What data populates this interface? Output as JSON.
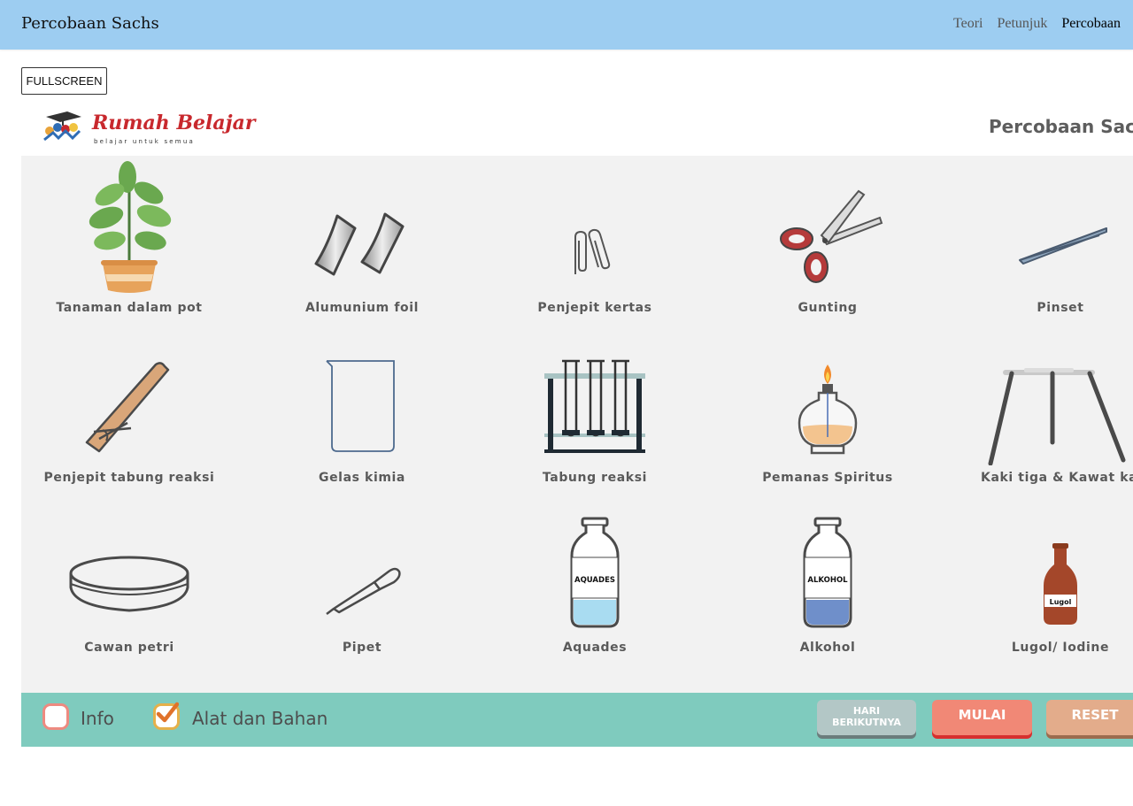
{
  "navbar": {
    "brand": "Percobaan Sachs",
    "links": [
      "Teori",
      "Petunjuk",
      "Percobaan"
    ]
  },
  "fullscreen_label": "FULLSCREEN",
  "simulation": {
    "logo_title": "Rumah Belajar",
    "logo_subtitle": "belajar untuk semua",
    "title": "Percobaan Sachs",
    "items": [
      "Tanaman dalam pot",
      "Alumunium foil",
      "Penjepit kertas",
      "Gunting",
      "Pinset",
      "Penjepit tabung reaksi",
      "Gelas kimia",
      "Tabung reaksi",
      "Pemanas Spiritus",
      "Kaki tiga & Kawat kasa",
      "Cawan petri",
      "Pipet",
      "Aquades",
      "Alkohol",
      "Lugol/ Iodine"
    ],
    "bottle_labels": {
      "aquades": "AQUADES",
      "alkohol": "ALKOHOL",
      "lugol": "Lugol"
    },
    "toggles": [
      {
        "label": "Info",
        "checked": false
      },
      {
        "label": "Alat dan Bahan",
        "checked": true
      }
    ],
    "buttons": {
      "next_line1": "HARI",
      "next_line2": "BERIKUTNYA",
      "start": "MULAI",
      "reset": "RESET"
    }
  },
  "colors": {
    "navbar_bg": "#9dcdf1",
    "stage_bg": "#f2f2f2",
    "bottombar_bg": "#7fcbbe",
    "start_button": "#f18876",
    "reset_button": "#e3ac8b",
    "next_button": "#b3c7c6"
  }
}
